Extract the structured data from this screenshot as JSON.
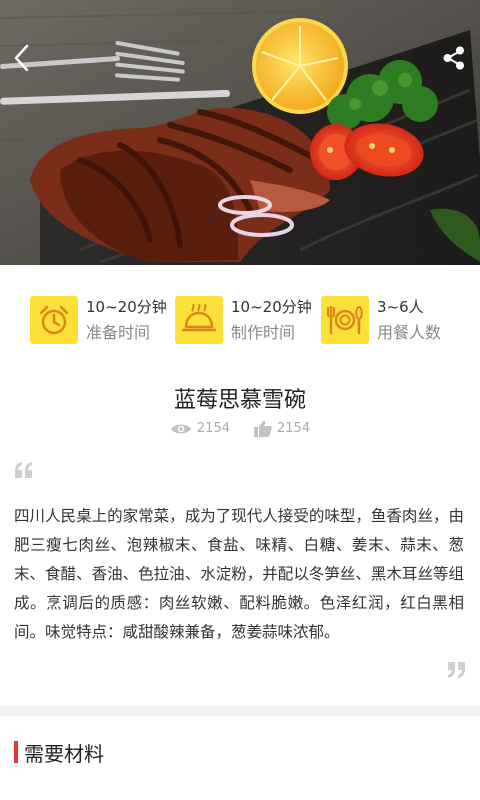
{
  "hero": {
    "back_icon": "chevron-left-icon",
    "share_icon": "share-icon"
  },
  "stats": [
    {
      "icon": "alarm-clock-icon",
      "value": "10~20分钟",
      "label": "准备时间"
    },
    {
      "icon": "cloche-icon",
      "value": "10~20分钟",
      "label": "制作时间"
    },
    {
      "icon": "cutlery-plate-icon",
      "value": "3~6人",
      "label": "用餐人数"
    }
  ],
  "recipe": {
    "title": "蓝莓思慕雪碗",
    "views": "2154",
    "likes": "2154",
    "description": "四川人民桌上的家常菜，成为了现代人接受的味型，鱼香肉丝，由肥三瘦七肉丝、泡辣椒末、食盐、味精、白糖、姜末、蒜末、葱末、食醋、香油、色拉油、水淀粉，并配以冬笋丝、黑木耳丝等组成。烹调后的质感：肉丝软嫩、配料脆嫩。色泽红润，红白黑相间。味觉特点：咸甜酸辣兼备，葱姜蒜味浓郁。"
  },
  "section": {
    "title": "需要材料"
  },
  "colors": {
    "accent_yellow": "#fbe03a",
    "section_bar": "#e8322f",
    "muted_text": "#888888"
  }
}
